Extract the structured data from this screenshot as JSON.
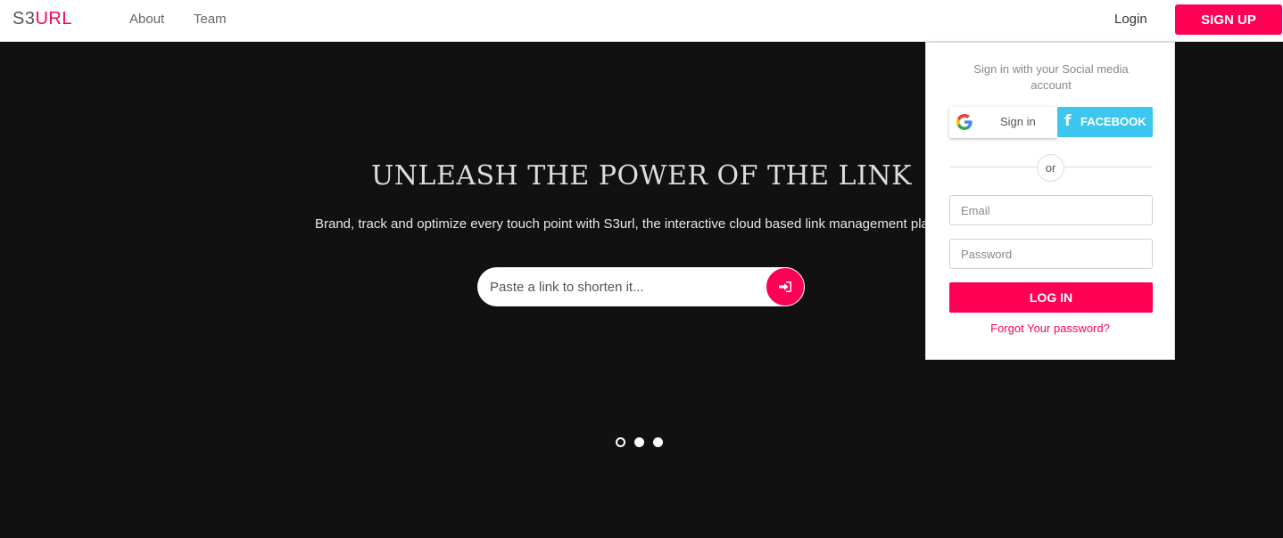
{
  "brand": {
    "logo_prefix": "S3",
    "logo_suffix": "URL",
    "accent_color": "#ff0055"
  },
  "nav": {
    "links": [
      "About",
      "Team"
    ],
    "login_label": "Login",
    "signup_label": "SIGN UP"
  },
  "hero": {
    "title": "UNLEASH THE POWER OF THE LINK",
    "subtitle": "Brand, track and optimize every touch point with S3url, the interactive cloud based link management pla",
    "shorten_placeholder": "Paste a link to shorten it...",
    "shorten_icon": "sign-in-icon",
    "carousel": {
      "slides": 3,
      "active_index": 0
    }
  },
  "login_panel": {
    "social_text": "Sign in with your Social media account",
    "google_label": "Sign in",
    "facebook_label": "FACEBOOK",
    "facebook_color": "#3cc6f0",
    "or_label": "or",
    "email_placeholder": "Email",
    "password_placeholder": "Password",
    "login_button": "LOG IN",
    "forgot_link": "Forgot Your password?"
  }
}
